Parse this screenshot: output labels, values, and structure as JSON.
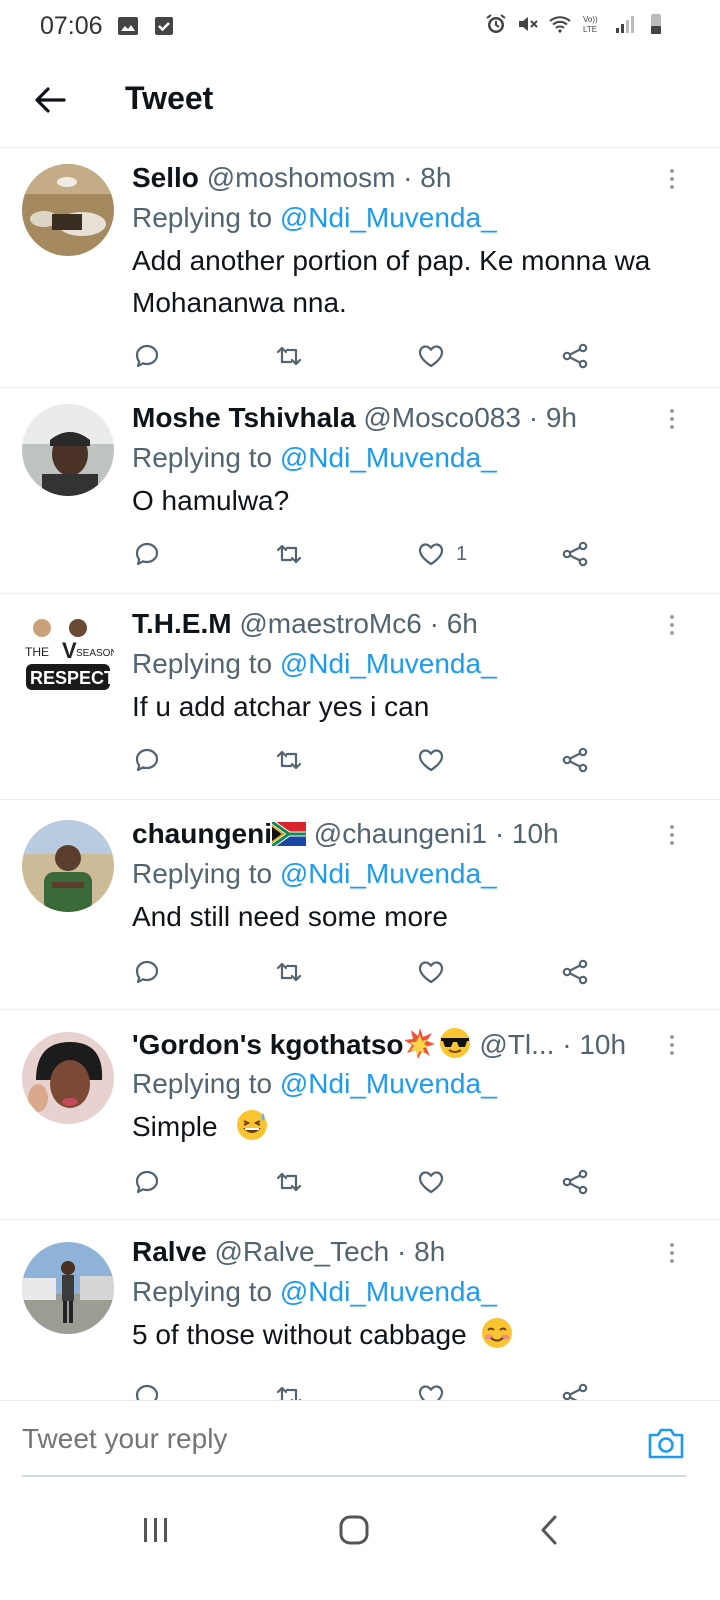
{
  "status_bar": {
    "time": "07:06",
    "left_icons": [
      "image-icon",
      "check-square-icon"
    ],
    "right_icons": [
      "alarm-icon",
      "mute-icon",
      "wifi-icon",
      "volte-icon",
      "signal-icon",
      "battery-icon"
    ],
    "volte_text": "Vo)) LTE"
  },
  "header": {
    "title": "Tweet",
    "back_icon": "arrow-left-icon"
  },
  "colors": {
    "mention": "#1d9bf0",
    "secondary_text": "#536471",
    "divider": "#e6ecf0",
    "primary_text": "#0f1419"
  },
  "tweets": [
    {
      "name": "Sello",
      "handle": "@moshomosm",
      "dot": "·",
      "time": "8h",
      "replying_prefix": "Replying to ",
      "replying_to": "@Ndi_Muvenda_",
      "text": "Add another portion of pap. Ke monna wa Mohananwa nna.",
      "like_count": ""
    },
    {
      "name": "Moshe Tshivhala",
      "handle": "@Mosco083",
      "dot": "·",
      "time": "9h",
      "replying_prefix": "Replying to ",
      "replying_to": "@Ndi_Muvenda_",
      "text": "O hamulwa?",
      "like_count": "1"
    },
    {
      "name": "T.H.E.M",
      "handle": "@maestroMc6",
      "dot": "·",
      "time": "6h",
      "replying_prefix": "Replying to ",
      "replying_to": "@Ndi_Muvenda_",
      "text": "If u add atchar yes i can",
      "like_count": "",
      "avatar_text": [
        "THE",
        "SEASON",
        "RESPECT"
      ]
    },
    {
      "name": "chaungeni",
      "name_emoji": "south-africa-flag",
      "handle": "@chaungeni1",
      "dot": "·",
      "time": "10h",
      "replying_prefix": "Replying to ",
      "replying_to": "@Ndi_Muvenda_",
      "text": "And still need some more",
      "like_count": ""
    },
    {
      "name": "'Gordon's kgothatso",
      "name_emoji": "collision-sunglasses",
      "handle": "@Tl...",
      "dot": "·",
      "time": "10h",
      "replying_prefix": "Replying to ",
      "replying_to": "@Ndi_Muvenda_",
      "text": "Simple",
      "text_emoji": "grinning-sweat",
      "like_count": ""
    },
    {
      "name": "Ralve",
      "handle": "@Ralve_Tech",
      "dot": "·",
      "time": "8h",
      "replying_prefix": "Replying to ",
      "replying_to": "@Ndi_Muvenda_",
      "text": "5 of those without cabbage",
      "text_emoji": "smiling-blush",
      "like_count": ""
    }
  ],
  "composer": {
    "placeholder": "Tweet your reply",
    "camera_icon": "camera-icon"
  },
  "nav_bar": {
    "icons": [
      "recent-apps-icon",
      "home-icon",
      "back-icon"
    ]
  }
}
